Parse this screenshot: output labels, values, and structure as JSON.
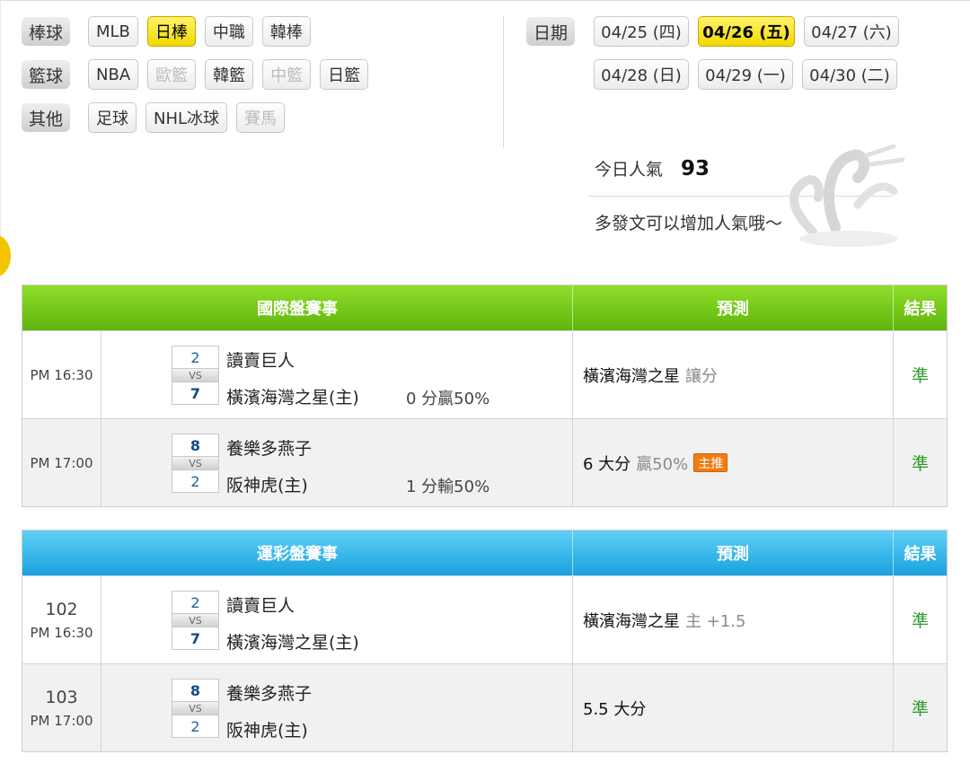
{
  "categories": [
    {
      "label": "棒球",
      "items": [
        {
          "label": "MLB",
          "state": "normal"
        },
        {
          "label": "日棒",
          "state": "active"
        },
        {
          "label": "中職",
          "state": "normal"
        },
        {
          "label": "韓棒",
          "state": "normal"
        }
      ]
    },
    {
      "label": "籃球",
      "items": [
        {
          "label": "NBA",
          "state": "normal"
        },
        {
          "label": "歐籃",
          "state": "disabled"
        },
        {
          "label": "韓籃",
          "state": "normal"
        },
        {
          "label": "中籃",
          "state": "disabled"
        },
        {
          "label": "日籃",
          "state": "normal"
        }
      ]
    },
    {
      "label": "其他",
      "items": [
        {
          "label": "足球",
          "state": "normal"
        },
        {
          "label": "NHL冰球",
          "state": "normal"
        },
        {
          "label": "賽馬",
          "state": "disabled"
        }
      ]
    }
  ],
  "dates": {
    "label": "日期",
    "items": [
      {
        "label": "04/25 (四)",
        "state": "normal"
      },
      {
        "label": "04/26 (五)",
        "state": "active"
      },
      {
        "label": "04/27 (六)",
        "state": "normal"
      },
      {
        "label": "04/28 (日)",
        "state": "normal"
      },
      {
        "label": "04/29 (一)",
        "state": "normal"
      },
      {
        "label": "04/30 (二)",
        "state": "normal"
      }
    ]
  },
  "popularity": {
    "label": "今日人氣",
    "value": "93",
    "tip": "多發文可以增加人氣哦～"
  },
  "international": {
    "header": {
      "game": "國際盤賽事",
      "prediction": "預測",
      "result": "結果"
    },
    "rows": [
      {
        "time": "PM 16:30",
        "away": {
          "name": "讀賣巨人",
          "score": "2"
        },
        "home": {
          "name": "橫濱海灣之星(主)",
          "score": "7"
        },
        "odds": "0 分贏50%",
        "prediction": "橫濱海灣之星",
        "prediction_note": "讓分",
        "badge": "",
        "result": "準"
      },
      {
        "time": "PM 17:00",
        "away": {
          "name": "養樂多燕子",
          "score": "8"
        },
        "home": {
          "name": "阪神虎(主)",
          "score": "2"
        },
        "odds": "1 分輸50%",
        "prediction": "6 大分",
        "prediction_note": "贏50%",
        "badge": "主推",
        "result": "準"
      }
    ]
  },
  "sports_lottery": {
    "header": {
      "game": "運彩盤賽事",
      "prediction": "預測",
      "result": "結果"
    },
    "rows": [
      {
        "no": "102",
        "time": "PM 16:30",
        "away": {
          "name": "讀賣巨人",
          "score": "2"
        },
        "home": {
          "name": "橫濱海灣之星(主)",
          "score": "7"
        },
        "prediction": "橫濱海灣之星",
        "prediction_note": "主 +1.5",
        "result": "準"
      },
      {
        "no": "103",
        "time": "PM 17:00",
        "away": {
          "name": "養樂多燕子",
          "score": "8"
        },
        "home": {
          "name": "阪神虎(主)",
          "score": "2"
        },
        "prediction": "5.5 大分",
        "prediction_note": "",
        "result": "準"
      }
    ]
  }
}
